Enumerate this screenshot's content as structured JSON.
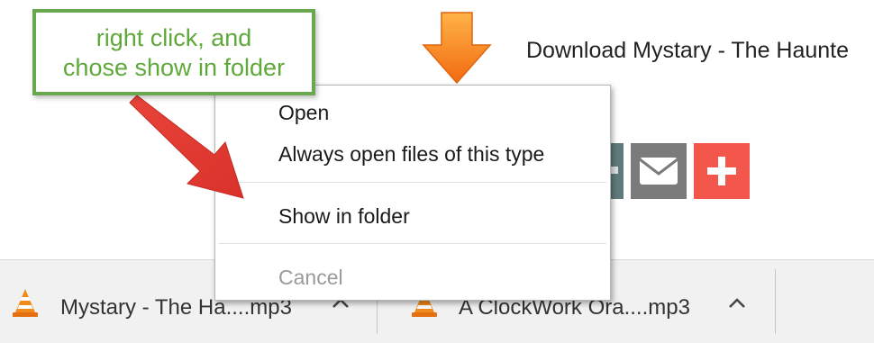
{
  "page": {
    "heading": "Download Mystary - The Haunte"
  },
  "callout": {
    "line1": "right click, and",
    "line2": "chose show in folder"
  },
  "context_menu": {
    "items": [
      {
        "label": "Open",
        "enabled": true
      },
      {
        "label": "Always open files of this type",
        "enabled": true
      },
      {
        "label": "Show in folder",
        "enabled": true
      },
      {
        "label": "Cancel",
        "enabled": false
      }
    ]
  },
  "download_bar": {
    "items": [
      {
        "file_name": "Mystary - The Ha....mp3",
        "icon": "vlc-cone-icon"
      },
      {
        "file_name": "A ClockWork Ora....mp3",
        "icon": "vlc-cone-icon"
      }
    ]
  },
  "share_buttons": [
    {
      "icon": "share-icon"
    },
    {
      "icon": "mail-icon"
    },
    {
      "icon": "plus-icon"
    }
  ],
  "colors": {
    "callout_border": "#6aa84f",
    "callout_text": "#5fa83a",
    "annotation_arrow": "#e8433a",
    "mail_button": "#7b7b7b",
    "plus_button": "#f3564b",
    "download_arrow": "#f7941d"
  }
}
